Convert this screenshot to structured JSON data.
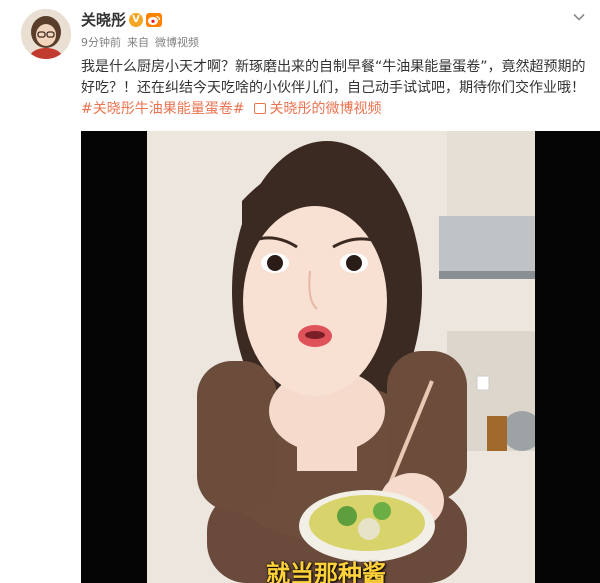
{
  "author": {
    "name": "关晓彤",
    "verified_badge": "V",
    "level_badge_icon": "weibo-level-icon"
  },
  "meta": {
    "time": "9分钟前",
    "source_prefix": "来自",
    "source": "微博视频"
  },
  "post": {
    "text_main": "我是什么厨房小天才啊？新琢磨出来的自制早餐“牛油果能量蛋卷”，竟然超预期的好吃？！还在纠结今天吃啥的小伙伴儿们，自己动手试试吧，期待你们交作业哦！",
    "hashtag": "#关晓彤牛油果能量蛋卷#",
    "video_link": "关晓彤的微博视频"
  },
  "video": {
    "subtitle": "就当那种酱"
  },
  "colors": {
    "link": "#eb7350",
    "verified": "#f6a623",
    "subtitle": "#ffd23a"
  },
  "icons": {
    "menu": "chevron-down-icon",
    "video_link": "video-link-icon"
  }
}
